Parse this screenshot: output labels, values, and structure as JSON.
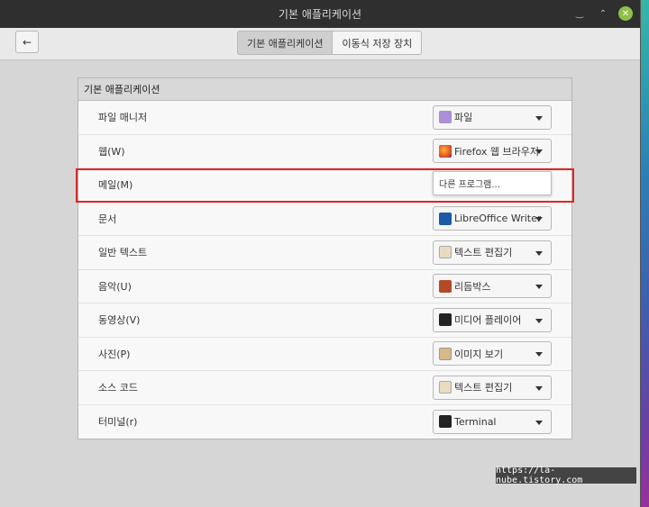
{
  "window": {
    "title": "기본 애플리케이션",
    "controls": {
      "minimize": "‿",
      "maximize": "⌃",
      "close": "✕"
    }
  },
  "header": {
    "back_icon": "←",
    "tabs": [
      {
        "label": "기본 애플리케이션",
        "active": true
      },
      {
        "label": "이동식 저장 장치",
        "active": false
      }
    ]
  },
  "panel": {
    "title": "기본 애플리케이션",
    "rows": [
      {
        "label": "파일 매니저",
        "app": "파일",
        "icon": "folder-icon"
      },
      {
        "label": "웹(W)",
        "app": "Firefox 웹 브라우저",
        "icon": "firefox-icon"
      },
      {
        "label": "메일(M)",
        "app": "다른 프로그램...",
        "icon": "",
        "popup": true
      },
      {
        "label": "문서",
        "app": "LibreOffice Writer",
        "icon": "libreoffice-icon"
      },
      {
        "label": "일반 텍스트",
        "app": "텍스트 편집기",
        "icon": "text-editor-icon"
      },
      {
        "label": "음악(U)",
        "app": "리듬박스",
        "icon": "rhythmbox-icon"
      },
      {
        "label": "동영상(V)",
        "app": "미디어 플레이어",
        "icon": "media-player-icon"
      },
      {
        "label": "사진(P)",
        "app": "이미지 보기",
        "icon": "image-viewer-icon"
      },
      {
        "label": "소스 코드",
        "app": "텍스트 편집기",
        "icon": "text-editor-icon"
      },
      {
        "label": "터미널(r)",
        "app": "Terminal",
        "icon": "terminal-icon"
      }
    ]
  },
  "highlight_color": "#e02424",
  "watermark": "https://la-nube.tistory.com"
}
